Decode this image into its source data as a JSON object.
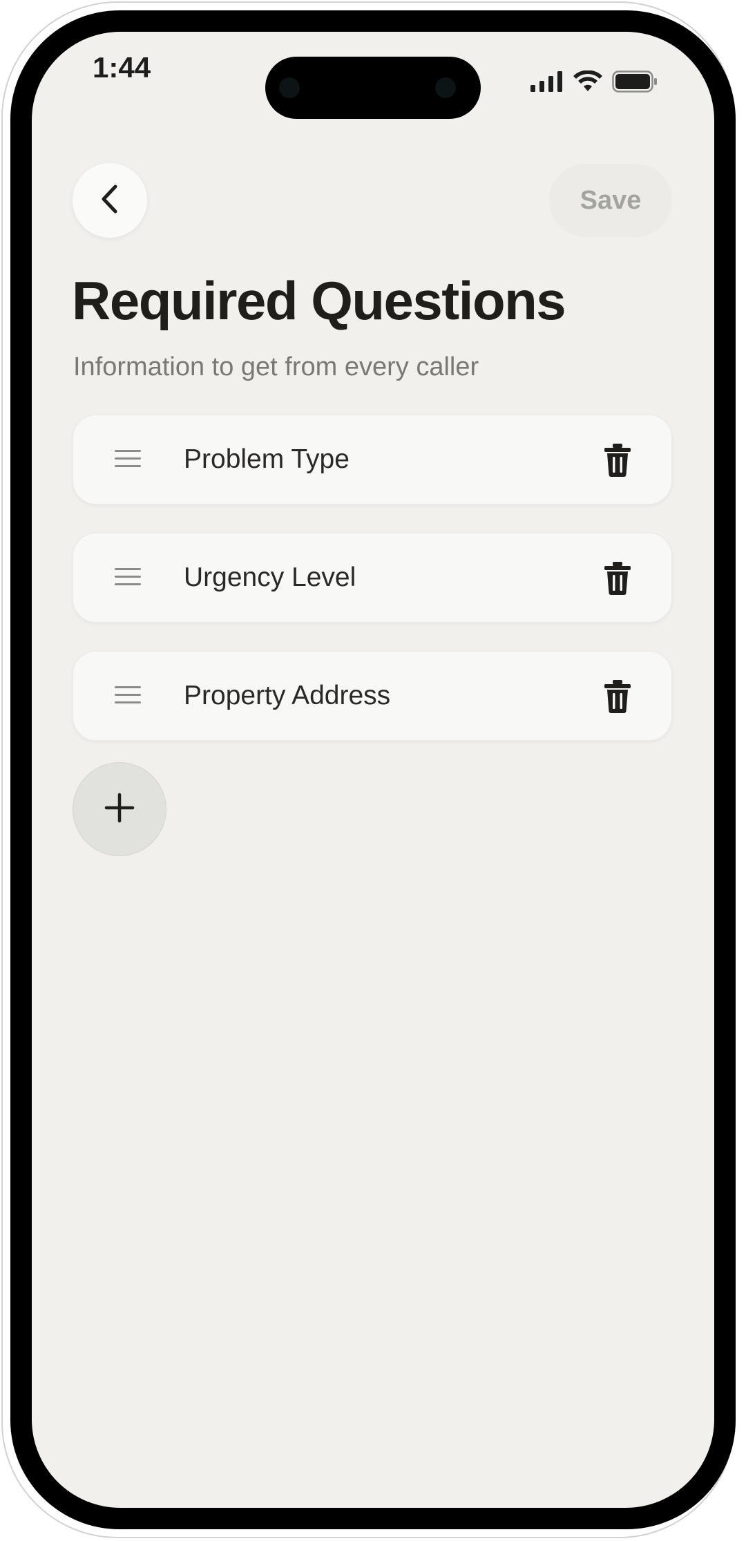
{
  "status_bar": {
    "time": "1:44",
    "icons": [
      "cellular-signal-icon",
      "wifi-icon",
      "battery-icon"
    ]
  },
  "header": {
    "back_icon": "chevron-left-icon",
    "save_label": "Save"
  },
  "page": {
    "title": "Required Questions",
    "subtitle": "Information to get from every caller"
  },
  "questions": [
    {
      "label": "Problem Type"
    },
    {
      "label": "Urgency Level"
    },
    {
      "label": "Property Address"
    }
  ],
  "add_button_icon": "plus-icon",
  "colors": {
    "background": "#f1f0ed",
    "card": "#f8f8f7",
    "text_primary": "#1f1e1b",
    "text_secondary": "#7a7874",
    "save_disabled_text": "#a3a3a0",
    "add_button": "#e1e1dd"
  }
}
